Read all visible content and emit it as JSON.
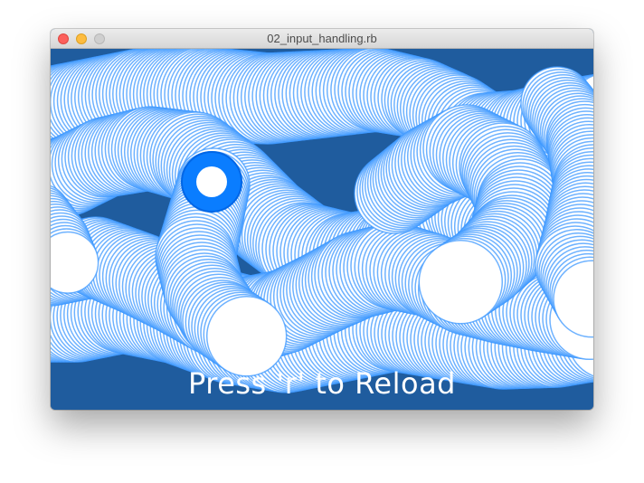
{
  "window": {
    "title": "02_input_handling.rb",
    "controls": [
      "close",
      "minimize",
      "zoom"
    ]
  },
  "canvas": {
    "background_color": "#1f5c9e",
    "circle_stroke_color": "#3d98ff",
    "circle_fill_color": "#ffffff",
    "cursor_color": "#0a7dff",
    "reload_prompt": "Press 'r' to Reload"
  }
}
